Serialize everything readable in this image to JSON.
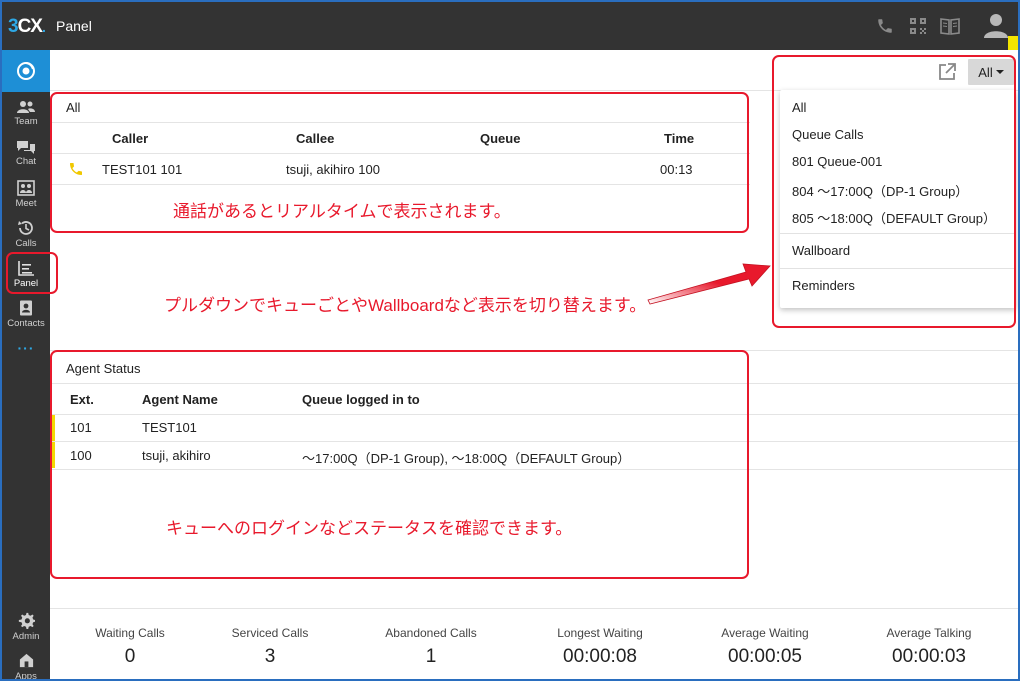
{
  "app": {
    "logo": "3CX",
    "title": "Panel"
  },
  "sidebar": {
    "items": [
      {
        "key": "team",
        "label": "Team"
      },
      {
        "key": "chat",
        "label": "Chat"
      },
      {
        "key": "meet",
        "label": "Meet"
      },
      {
        "key": "calls",
        "label": "Calls"
      },
      {
        "key": "panel",
        "label": "Panel"
      },
      {
        "key": "contacts",
        "label": "Contacts"
      },
      {
        "key": "admin",
        "label": "Admin"
      },
      {
        "key": "apps",
        "label": "Apps"
      }
    ],
    "more": "···"
  },
  "calls_section": {
    "title": "All",
    "headers": {
      "caller": "Caller",
      "callee": "Callee",
      "queue": "Queue",
      "time": "Time"
    },
    "rows": [
      {
        "caller": "TEST101 101",
        "callee": "tsuji, akihiro 100",
        "queue": "",
        "time": "00:13"
      }
    ]
  },
  "dropdown": {
    "selected": "All",
    "items": [
      "All",
      "Queue Calls",
      "801 Queue-001",
      "804 〜17:00Q（DP-1 Group）",
      "805 〜18:00Q（DEFAULT Group）",
      "Wallboard",
      "Reminders"
    ]
  },
  "agent_section": {
    "title": "Agent Status",
    "headers": {
      "ext": "Ext.",
      "name": "Agent Name",
      "queue": "Queue logged in to"
    },
    "rows": [
      {
        "ext": "101",
        "name": "TEST101",
        "queue": ""
      },
      {
        "ext": "100",
        "name": "tsuji, akihiro",
        "queue": "〜17:00Q（DP-1 Group), 〜18:00Q（DEFAULT Group）"
      }
    ]
  },
  "annotations": {
    "calls": "通話があるとリアルタイムで表示されます。",
    "dropdown": "プルダウンでキューごとやWallboardなど表示を切り替えます。",
    "agents": "キューへのログインなどステータスを確認できます。"
  },
  "stats": [
    {
      "label": "Waiting Calls",
      "value": "0"
    },
    {
      "label": "Serviced Calls",
      "value": "3"
    },
    {
      "label": "Abandoned Calls",
      "value": "1"
    },
    {
      "label": "Longest Waiting",
      "value": "00:00:08"
    },
    {
      "label": "Average Waiting",
      "value": "00:00:05"
    },
    {
      "label": "Average Talking",
      "value": "00:00:03"
    }
  ],
  "colors": {
    "accent": "#1e8fd6",
    "annotation": "#e8192c",
    "status_marker": "#f3d800",
    "topbar": "#333333"
  },
  "icons": [
    "phone-icon",
    "qr-code-icon",
    "book-icon",
    "user-avatar-icon",
    "external-link-icon",
    "team-icon",
    "chat-icon",
    "meet-icon",
    "calls-icon",
    "panel-icon",
    "contacts-icon",
    "admin-gear-icon",
    "apps-icon",
    "ringing-phone-icon"
  ]
}
